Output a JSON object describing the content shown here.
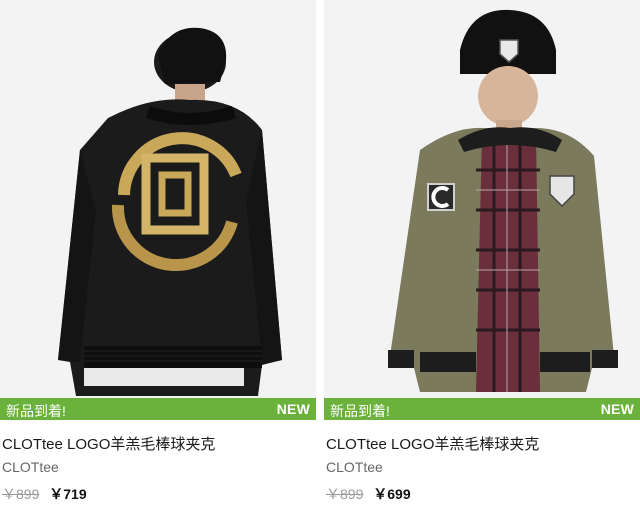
{
  "products": [
    {
      "badge_left": "新品到着!",
      "badge_right": "NEW",
      "title": "CLOTtee LOGO羊羔毛棒球夹克",
      "brand": "CLOTtee",
      "old_price": "￥899",
      "new_price": "￥719",
      "image": "black bomber jacket with gold CLOT logo, back view"
    },
    {
      "badge_left": "新品到着!",
      "badge_right": "NEW",
      "title": "CLOTtee LOGO羊羔毛棒球夹克",
      "brand": "CLOTtee",
      "old_price": "￥899",
      "new_price": "￥699",
      "image": "olive bomber jacket, model in black beanie, front view"
    }
  ],
  "colors": {
    "banner": "#6ab23c",
    "jacket_black": "#1b1b1b",
    "jacket_olive": "#7b7a5c",
    "logo_gold": "#c9a85a"
  }
}
